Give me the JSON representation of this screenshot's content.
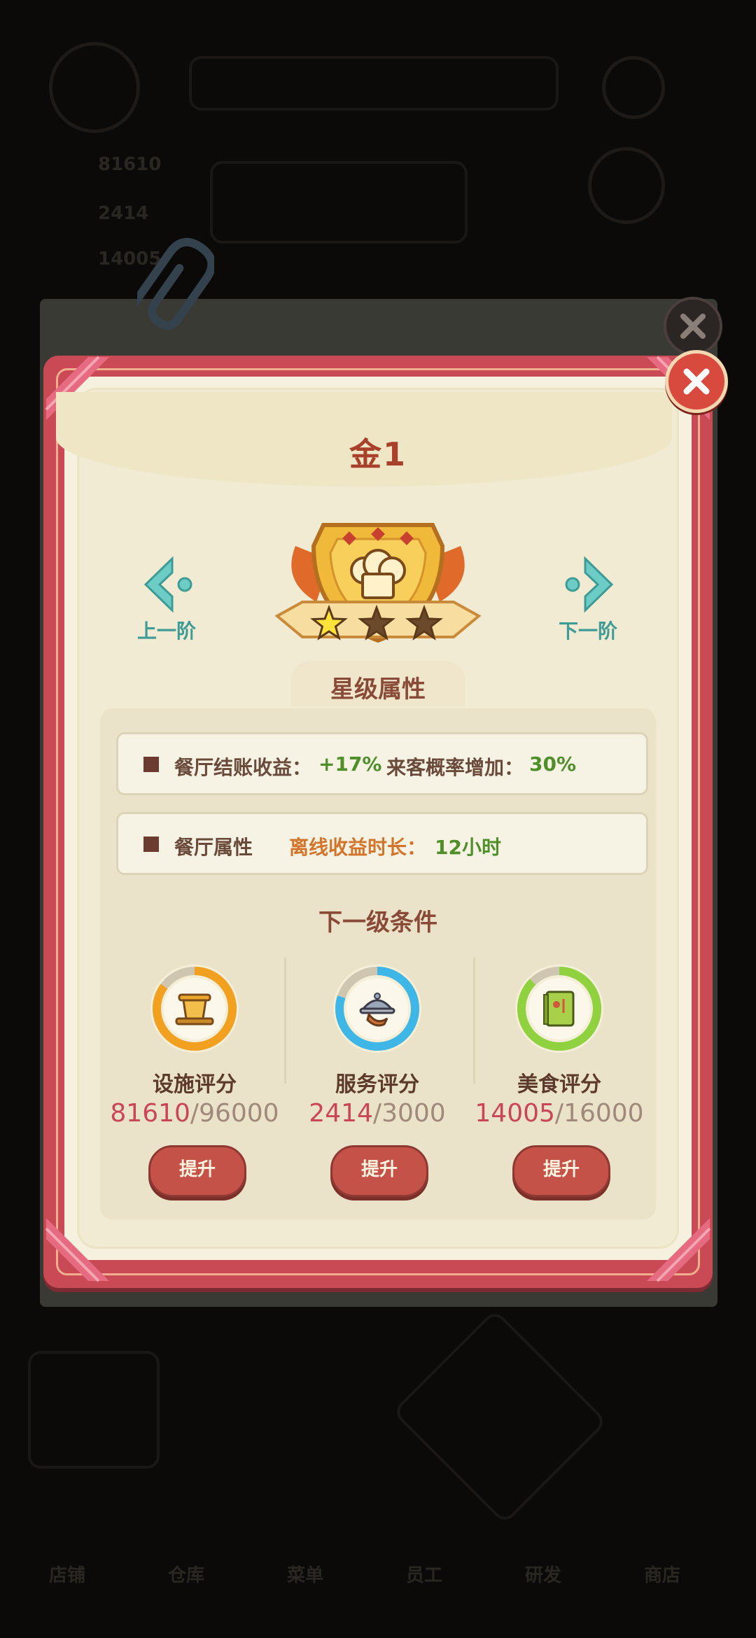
{
  "background": {
    "texts": [
      "81610",
      "2414",
      "14005",
      "店铺",
      "仓库",
      "菜单",
      "员工",
      "研发",
      "商店"
    ]
  },
  "dialog": {
    "title": "金1",
    "prev_label": "上一阶",
    "next_label": "下一阶",
    "stars": {
      "filled": 1,
      "total": 3
    },
    "section_title": "星级属性",
    "attributes": [
      {
        "label": "餐厅结账收益：",
        "value": "+17%",
        "label2": "来客概率增加：",
        "value2": "30%"
      },
      {
        "label": "餐厅属性",
        "label2": "离线收益时长：",
        "value2": "12小时"
      }
    ],
    "conditions_title": "下一级条件",
    "conditions": [
      {
        "name": "设施评分",
        "current": "81610",
        "sep": "/",
        "max": "96000",
        "ring_color": "#f2a020",
        "progress": 0.85,
        "icon": "pot-icon",
        "button": "提升"
      },
      {
        "name": "服务评分",
        "current": "2414",
        "sep": "/",
        "max": "3000",
        "ring_color": "#3fb7e6",
        "progress": 0.8,
        "icon": "serving-tray-icon",
        "button": "提升"
      },
      {
        "name": "美食评分",
        "current": "14005",
        "sep": "/",
        "max": "16000",
        "ring_color": "#8fd13f",
        "progress": 0.875,
        "icon": "recipe-book-icon",
        "button": "提升"
      }
    ]
  },
  "colors": {
    "frame": "#c94a55",
    "paper": "#f6f1de",
    "accent_green": "#4f8f2a",
    "accent_orange": "#d27429"
  }
}
